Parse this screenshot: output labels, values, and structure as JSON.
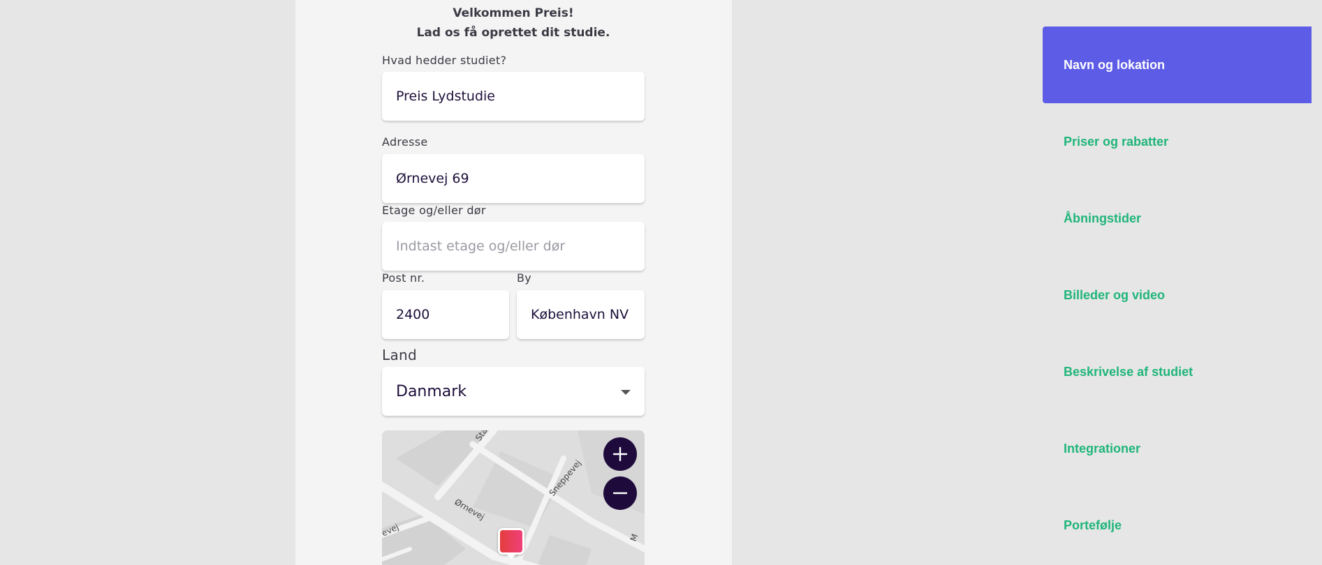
{
  "welcome": {
    "line1": "Velkommen Preis!",
    "line2": "Lad os få oprettet dit studie."
  },
  "form": {
    "name": {
      "label": "Hvad hedder studiet?",
      "value": "Preis Lydstudie"
    },
    "address": {
      "label": "Adresse",
      "value": "Ørnevej 69"
    },
    "floor": {
      "label": "Etage og/eller dør",
      "placeholder": "Indtast etage og/eller dør"
    },
    "postal": {
      "label": "Post nr.",
      "value": "2400"
    },
    "city": {
      "label": "By",
      "value": "København NV"
    },
    "country": {
      "label": "Land",
      "value": "Danmark"
    }
  },
  "map": {
    "streets": [
      "Sta",
      "Sneppevej",
      "Ørnevej",
      "evej",
      "M"
    ],
    "icons": {
      "zoom_in": "plus-icon",
      "zoom_out": "minus-icon",
      "marker": "map-pin-icon"
    }
  },
  "sidebar": {
    "items": [
      {
        "label": "Navn og lokation",
        "active": true
      },
      {
        "label": "Priser og rabatter",
        "active": false
      },
      {
        "label": "Åbningstider",
        "active": false
      },
      {
        "label": "Billeder og video",
        "active": false
      },
      {
        "label": "Beskrivelse af studiet",
        "active": false
      },
      {
        "label": "Integrationer",
        "active": false
      },
      {
        "label": "Portefølje",
        "active": false
      }
    ]
  },
  "colors": {
    "accent": "#5d5ce6",
    "link_green": "#1fb57a",
    "dark_button": "#1e0b3c",
    "marker": "#e43d3d"
  }
}
